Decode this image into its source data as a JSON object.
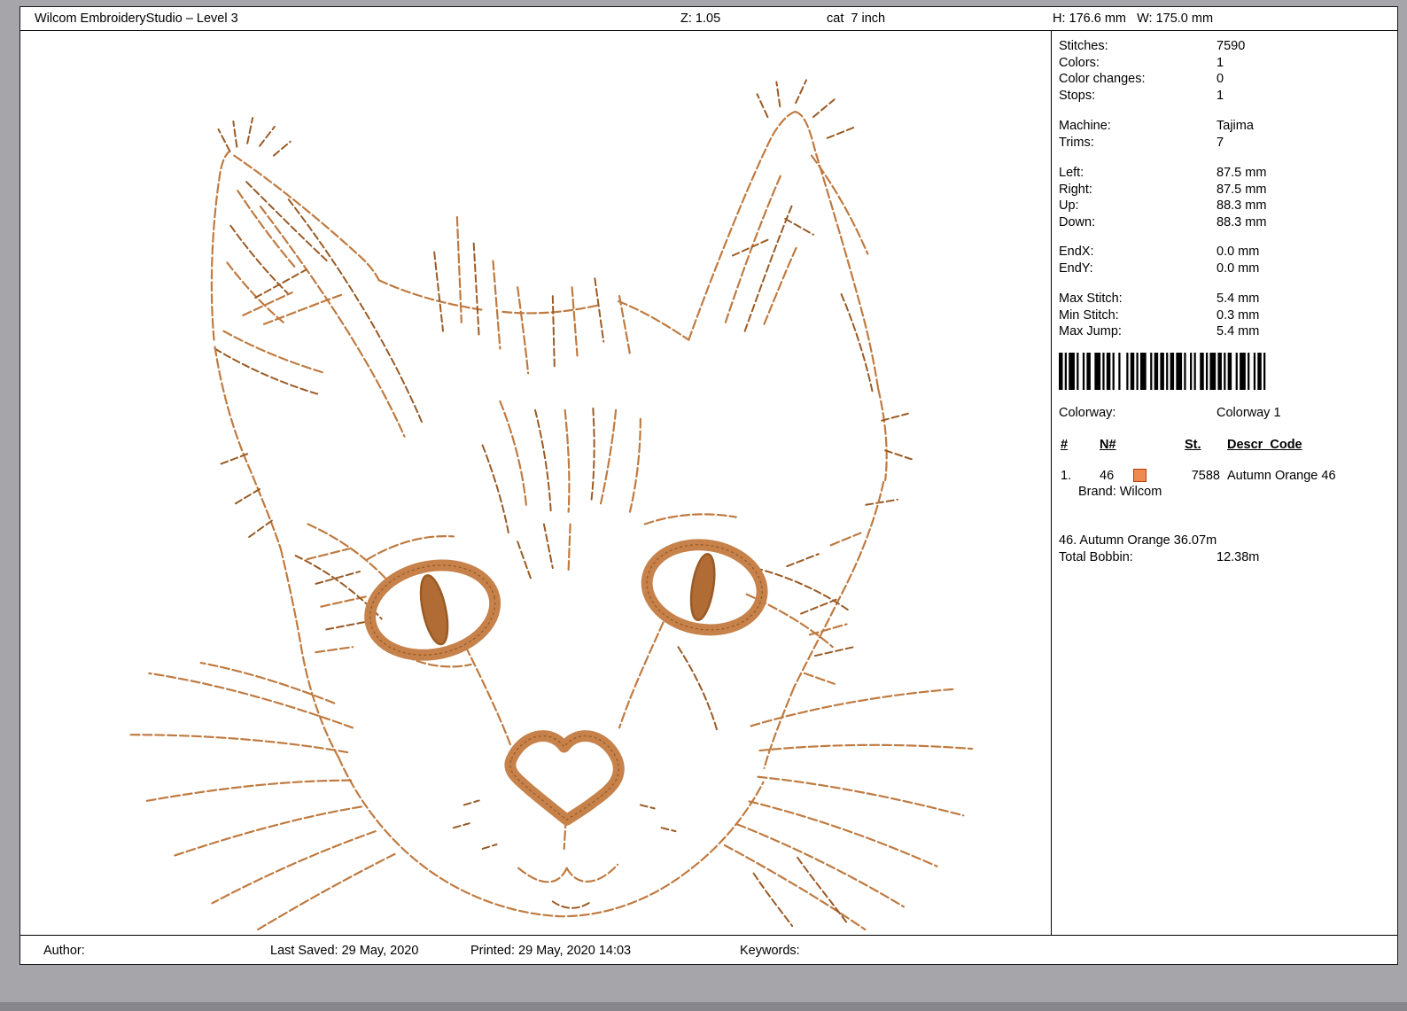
{
  "header": {
    "app_title": "Wilcom EmbroideryStudio – Level 3",
    "zoom": "Z: 1.05",
    "design_name": "cat  7 inch",
    "dimensions": "H: 176.6 mm   W: 175.0 mm"
  },
  "stats": {
    "groups": [
      {
        "rows": [
          {
            "label": "Stitches:",
            "value": "7590"
          },
          {
            "label": "Colors:",
            "value": "1"
          },
          {
            "label": "Color changes:",
            "value": "0"
          },
          {
            "label": "Stops:",
            "value": "1"
          }
        ]
      },
      {
        "rows": [
          {
            "label": "Machine:",
            "value": "Tajima"
          },
          {
            "label": "Trims:",
            "value": "7"
          }
        ]
      },
      {
        "rows": [
          {
            "label": "Left:",
            "value": "87.5 mm"
          },
          {
            "label": "Right:",
            "value": "87.5 mm"
          },
          {
            "label": "Up:",
            "value": "88.3 mm"
          },
          {
            "label": "Down:",
            "value": "88.3 mm"
          }
        ]
      },
      {
        "rows": [
          {
            "label": "EndX:",
            "value": "0.0 mm"
          },
          {
            "label": "EndY:",
            "value": "0.0 mm"
          }
        ]
      },
      {
        "rows": [
          {
            "label": "Max Stitch:",
            "value": "5.4 mm"
          },
          {
            "label": "Min Stitch:",
            "value": "0.3 mm"
          },
          {
            "label": "Max Jump:",
            "value": "5.4 mm"
          }
        ]
      }
    ],
    "colorway_label": "Colorway:",
    "colorway_value": "Colorway 1",
    "table": {
      "col_num": "#",
      "col_n": "N#",
      "col_st": "St.",
      "col_descr": "Descr_Code",
      "row": {
        "num": "1.",
        "n": "46",
        "st": "7588",
        "descr": "Autumn Orange 46",
        "swatch_color": "#ee8a50"
      },
      "brand": "Brand: Wilcom"
    },
    "thread_usage": "46. Autumn Orange 36.07m",
    "bobbin_label": "Total Bobbin:",
    "bobbin_value": "12.38m"
  },
  "footer": {
    "author": "Author:",
    "last_saved": "Last Saved: 29 May, 2020",
    "printed": "Printed: 29 May, 2020 14:03",
    "keywords": "Keywords:"
  },
  "design": {
    "subject": "cat-face-embroidery",
    "thread_color": "#bf7a40",
    "thread_dark": "#995a24",
    "satin_color": "#c6824a",
    "pupil_color": "#b06c34"
  }
}
